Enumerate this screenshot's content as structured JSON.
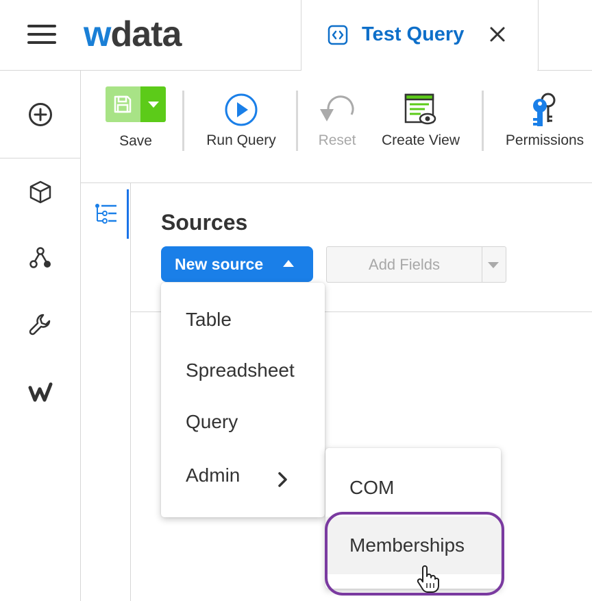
{
  "app": {
    "logo_w": "w",
    "logo_rest": "data",
    "brand_color": "#1a7fd6"
  },
  "tab": {
    "title": "Test Query",
    "icon": "code-file-icon"
  },
  "toolbar": {
    "save_label": "Save",
    "run_query_label": "Run Query",
    "reset_label": "Reset",
    "create_view_label": "Create View",
    "permissions_label": "Permissions"
  },
  "rail": {
    "icons": [
      "add-circle-icon",
      "cube-icon",
      "graph-nodes-icon",
      "wrench-icon",
      "workiva-w-icon"
    ]
  },
  "sources": {
    "title": "Sources",
    "new_source_label": "New source",
    "add_fields_label": "Add Fields"
  },
  "new_source_menu": {
    "items": [
      {
        "label": "Table"
      },
      {
        "label": "Spreadsheet"
      },
      {
        "label": "Query"
      },
      {
        "label": "Admin"
      }
    ]
  },
  "admin_submenu": {
    "items": [
      {
        "label": "COM"
      },
      {
        "label": "Memberships"
      }
    ],
    "hovered": "Memberships"
  },
  "colors": {
    "accent_blue": "#1a7fe8",
    "save_green": "#5ccb19",
    "highlight_purple": "#7a3aa0"
  }
}
